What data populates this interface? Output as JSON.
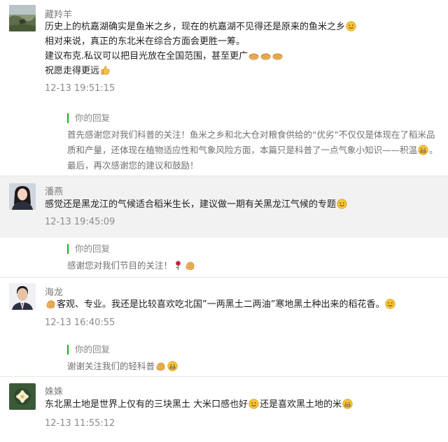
{
  "comments": [
    {
      "name": "藏羚羊",
      "lines": [
        "历史上的杭嘉湖确实是鱼米之乡，现在的杭嘉湖不见得还是原来的鱼米之乡",
        "相对来说，真正的东北米在综合方面会更胜一筹。",
        "建议布克.私议可以把目光放在全国范围，甚至更广",
        "祝愿走得更远"
      ],
      "time": "12-13 19:51:15",
      "reply_label": "你的回复",
      "reply_text": "首先感谢您对我们科普的关注！鱼米之乡和北大仓对粮食供给的“优劣”不仅仅是体现在了稻米品质和产量，还体现在植物适应性和气象风险方面，本篇只是科普了一点气象小知识——积温",
      "reply_text_2": "。最后，再次感谢您的建议和鼓励！"
    },
    {
      "name": "潘燕",
      "lines": [
        "感觉还是黑龙江的气候适合稻米生长，建议做一期有关黑龙江气候的专题"
      ],
      "time": "12-13 19:45:09",
      "reply_label": "你的回复",
      "reply_text": "感谢您对我们节目的关注！"
    },
    {
      "name": "海龙",
      "lines": [
        "客观、专业。我还是比较喜欢吃北国”一两黑土二两油”寒地黑土种出来的稻花香。"
      ],
      "time": "12-13 16:40:55",
      "reply_label": "你的回复",
      "reply_text": "谢谢关注我们的轻科普"
    },
    {
      "name": "姝姝",
      "lines": [
        "东北黑土地是世界上仅有的三块黑土 大米口感也好",
        "还是喜欢黑土地的米"
      ],
      "time": "12-13 11:55:12"
    }
  ],
  "icons": {
    "smile": "smile-emoji",
    "cheer": "cheer-emoji",
    "thumb": "thumbs-up-emoji",
    "rose": "rose-emoji",
    "grin": "grin-emoji",
    "fist": "fist-emoji"
  }
}
